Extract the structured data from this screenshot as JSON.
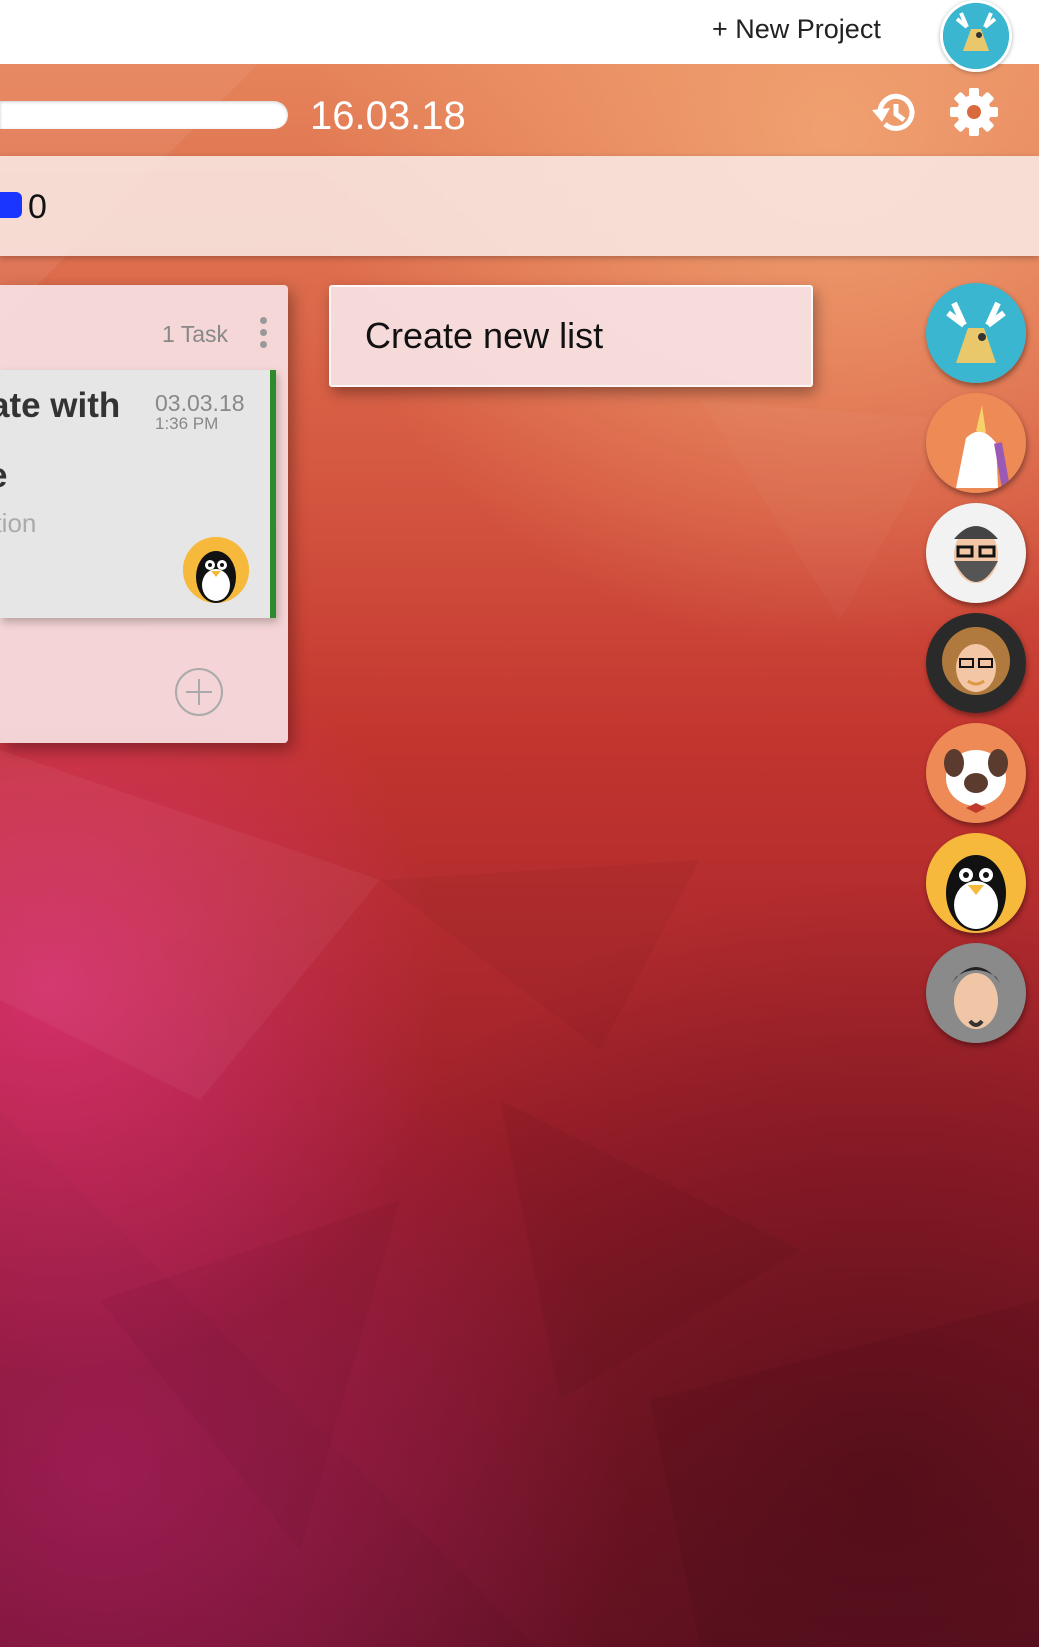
{
  "topbar": {
    "new_project_label": "+ New Project",
    "user_avatar": "moose-avatar"
  },
  "project": {
    "date": "16.03.18",
    "search_value": ""
  },
  "stats": {
    "color": "#1a35ff",
    "count": "0"
  },
  "list": {
    "task_count": "1 Task",
    "tasks": [
      {
        "title_fragment": "ate with",
        "title_fragment_2": "e",
        "desc_fragment": "ption",
        "date": "03.03.18",
        "time": "1:36 PM",
        "assignee": "penguin-avatar",
        "status_color": "#2d8a2d"
      }
    ]
  },
  "create_list_label": "Create new list",
  "members": [
    {
      "avatar": "moose-avatar",
      "color": "#3bb6d0"
    },
    {
      "avatar": "unicorn-avatar",
      "color": "#ee8a55"
    },
    {
      "avatar": "bearded-man-avatar",
      "color": "#f2f2f2"
    },
    {
      "avatar": "curly-woman-avatar",
      "color": "#2a2a2a"
    },
    {
      "avatar": "pug-dog-avatar",
      "color": "#ee8a55"
    },
    {
      "avatar": "penguin-avatar",
      "color": "#f6b93b"
    },
    {
      "avatar": "dark-hair-man-avatar",
      "color": "#8a8a8a"
    }
  ]
}
